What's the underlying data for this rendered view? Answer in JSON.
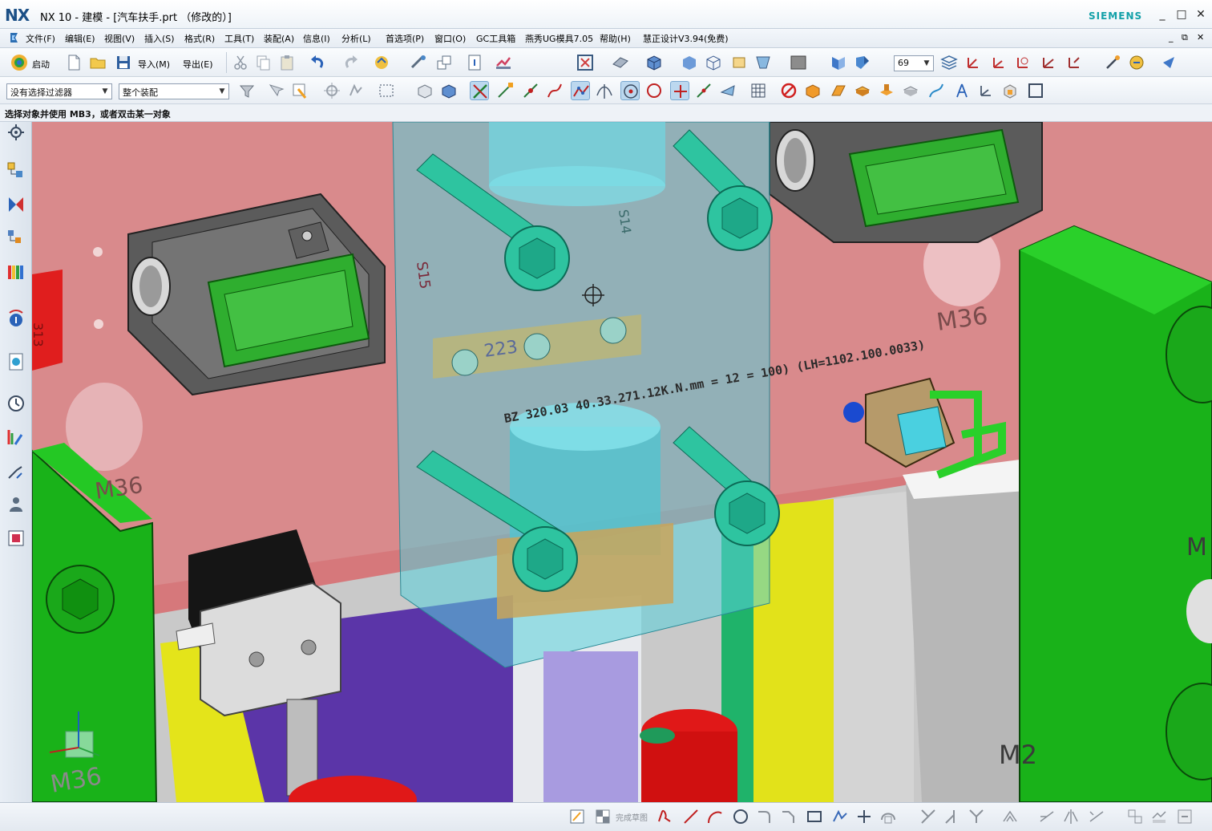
{
  "window": {
    "logo": "NX",
    "title": "NX 10 - 建模 - [汽车扶手.prt （修改的）]",
    "brand": "SIEMENS",
    "controls": [
      "_",
      "□",
      "✕"
    ]
  },
  "menu": {
    "items": [
      "文件(F)",
      "编辑(E)",
      "视图(V)",
      "插入(S)",
      "格式(R)",
      "工具(T)",
      "装配(A)",
      "信息(I)",
      "分析(L)",
      "首选项(P)",
      "窗口(O)",
      "GC工具箱",
      "燕秀UG模具7.05",
      "帮助(H)",
      "慧正设计V3.94(免费)"
    ],
    "window_controls": [
      "_",
      "⧉",
      "✕"
    ]
  },
  "toolbar1": {
    "start_label": "启动",
    "import_label": "导入(M)",
    "export_label": "导出(E)",
    "zoom_value": "69"
  },
  "toolbar2": {
    "filter_value": "没有选择过滤器",
    "scope_value": "整个装配"
  },
  "cue_line": {
    "text": "选择对象并使用 MB3，或者双击某一对象"
  },
  "viewport": {
    "labels": {
      "m36_right": "M36",
      "m36_left": "M36",
      "m36_bottom_left": "M36",
      "m_partial_right": "M",
      "m2_partial": "M2",
      "num_223": "223",
      "num_s15": "S15",
      "num_313": "313",
      "num_s14": "S14",
      "part_text": "BZ 320.03 40.33.271.12K.N.mm = 12 = 100) (LH=1102.100.0033)"
    }
  },
  "bottom_bar": {
    "finish_sketch_label": "完成草图"
  },
  "colors": {
    "plate": "#d97a7c",
    "green_block": "#19b219",
    "teal_bolt": "#2ec4a0",
    "translucent_cyan": "#5fd6e0",
    "purple": "#5a33a8",
    "yellow": "#e6e600",
    "red_part": "#e01818"
  }
}
